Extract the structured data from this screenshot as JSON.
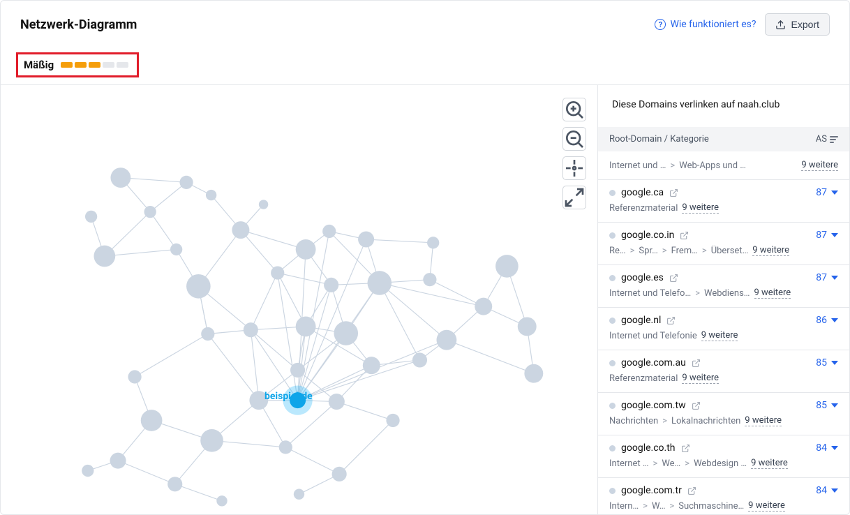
{
  "header": {
    "title": "Netzwerk-Diagramm",
    "how_link": "Wie funktioniert es?",
    "export": "Export"
  },
  "indicator": {
    "label": "Mäßig",
    "active_segments": 3,
    "total_segments": 5
  },
  "graph": {
    "central_label": "beispiel.de"
  },
  "sidebar": {
    "title": "Diese Domains verlinken auf naah.club",
    "col_domain": "Root-Domain / Kategorie",
    "col_as": "AS",
    "breadcrumb": {
      "a": "Internet und …",
      "b": "Web-Apps und …",
      "more": "9 weitere"
    },
    "rows": [
      {
        "domain": "google.ca",
        "as": "87",
        "cat_parts": [
          "Referenzmaterial"
        ],
        "more": "9 weitere"
      },
      {
        "domain": "google.co.in",
        "as": "87",
        "cat_parts": [
          "Re…",
          "Spr…",
          "Frem…",
          "Überset…"
        ],
        "more": "9 weitere"
      },
      {
        "domain": "google.es",
        "as": "87",
        "cat_parts": [
          "Internet und Telefo…",
          "Webdiens…"
        ],
        "more": "9 weitere"
      },
      {
        "domain": "google.nl",
        "as": "86",
        "cat_parts": [
          "Internet und Telefonie"
        ],
        "more": "9 weitere"
      },
      {
        "domain": "google.com.au",
        "as": "85",
        "cat_parts": [
          "Referenzmaterial"
        ],
        "more": "9 weitere"
      },
      {
        "domain": "google.com.tw",
        "as": "85",
        "cat_parts": [
          "Nachrichten",
          "Lokalnachrichten"
        ],
        "more": "9 weitere"
      },
      {
        "domain": "google.co.th",
        "as": "84",
        "cat_parts": [
          "Internet …",
          "We…",
          "Webdesign …"
        ],
        "more": "9 weitere"
      },
      {
        "domain": "google.com.tr",
        "as": "84",
        "cat_parts": [
          "Intern…",
          "W…",
          "Suchmaschine…"
        ],
        "more": "9 weitere"
      }
    ]
  },
  "chart_data": {
    "type": "network",
    "central_node": "beispiel.de",
    "description": "Force-directed backlink network graph. Central highlighted node 'beispiel.de' densely interconnected with ~25 nearby nodes; two looser peripheral wings (upper-left ~15 nodes, lower-left/bottom ~20 nodes) connected via hub nodes.",
    "node_count_estimate": 60,
    "edge_count_estimate": 150
  }
}
